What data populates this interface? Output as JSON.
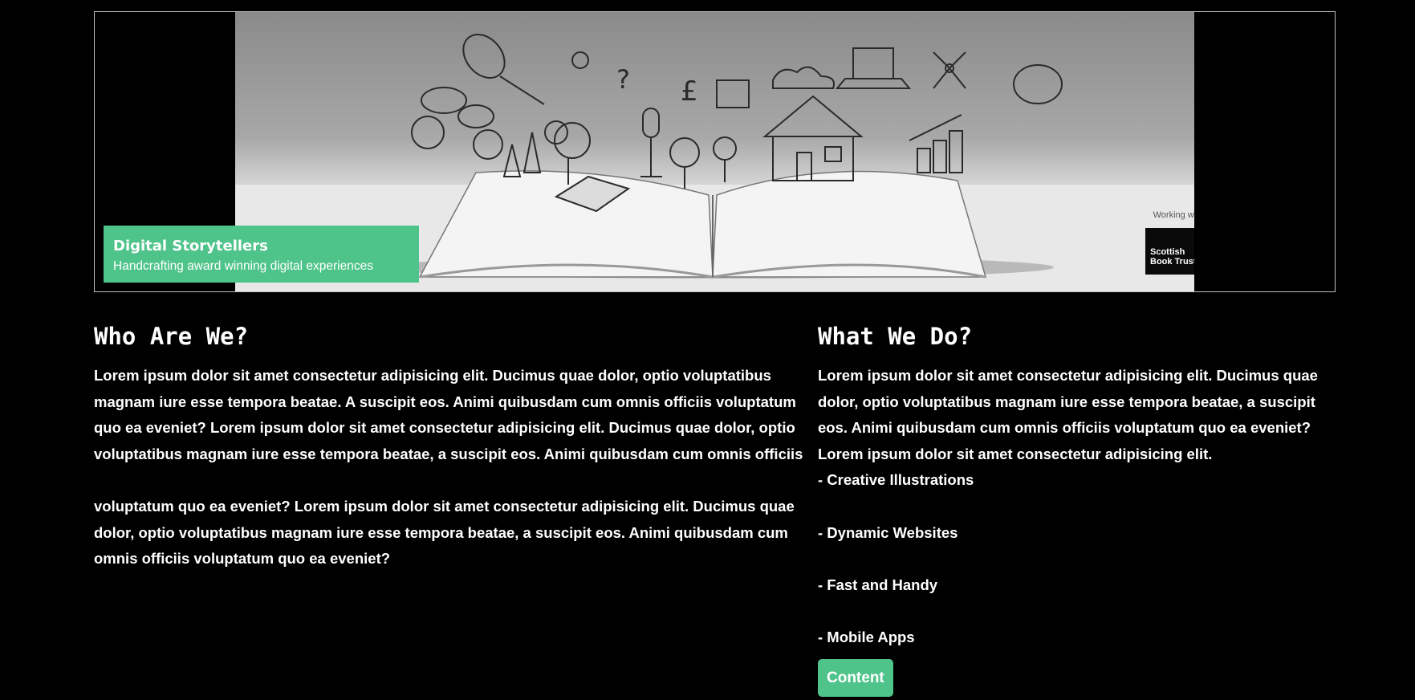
{
  "hero": {
    "brand_title": "Digital Storytellers",
    "brand_tagline": "Handcrafting award winning digital experiences",
    "partner_label": "Working with",
    "partner_logo_text": "Scottish\nBook Trust"
  },
  "who": {
    "title": "Who Are We?",
    "paragraph_1": "Lorem ipsum dolor sit amet consectetur adipisicing elit. Ducimus quae dolor, optio voluptatibus magnam iure esse tempora beatae. A suscipit eos. Animi quibusdam cum omnis officiis voluptatum quo ea eveniet? Lorem ipsum dolor sit amet consectetur adipisicing elit. Ducimus quae dolor, optio voluptatibus magnam iure esse tempora beatae, a suscipit eos. Animi quibusdam cum omnis officiis",
    "paragraph_2": "voluptatum quo ea eveniet? Lorem ipsum dolor sit amet consectetur adipisicing elit. Ducimus quae dolor, optio voluptatibus magnam iure esse tempora beatae, a suscipit eos. Animi quibusdam cum omnis officiis voluptatum quo ea eveniet?"
  },
  "what": {
    "title": "What We Do?",
    "paragraph": "Lorem ipsum dolor sit amet consectetur adipisicing elit. Ducimus quae dolor, optio voluptatibus magnam iure esse tempora beatae, a suscipit eos. Animi quibusdam cum omnis officiis voluptatum quo ea eveniet? Lorem ipsum dolor sit amet consectetur adipisicing elit.",
    "features": [
      "- Creative Illustrations",
      "- Dynamic Websites",
      "- Fast and Handy",
      "- Mobile Apps"
    ],
    "button_label": "Content"
  },
  "colors": {
    "background": "#000000",
    "accent": "#4fc48a",
    "text": "#ffffff"
  }
}
